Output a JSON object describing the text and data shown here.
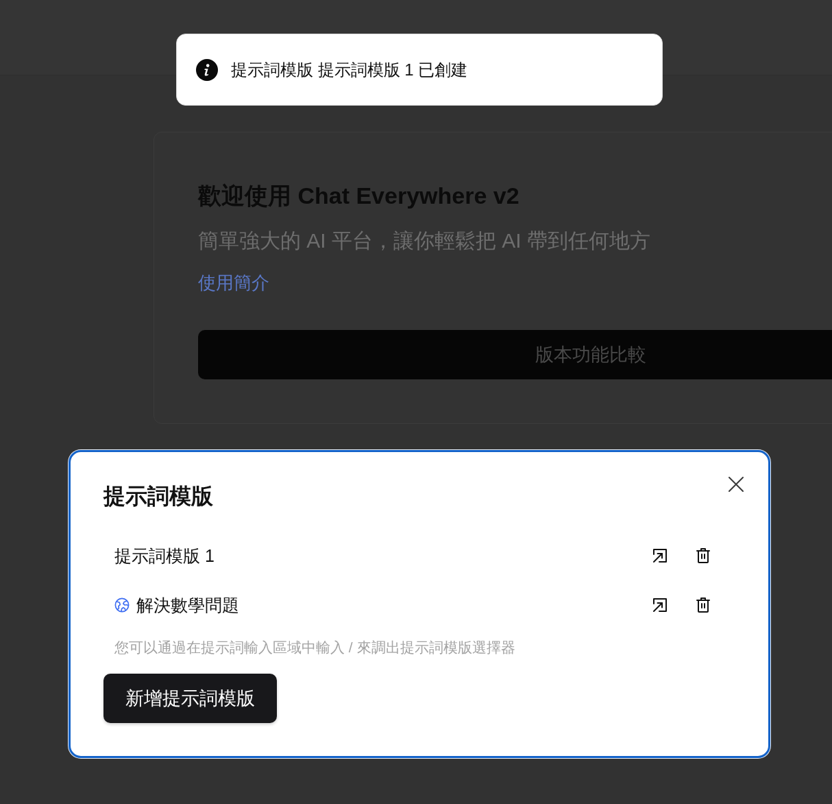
{
  "toast": {
    "message": "提示詞模版 提示詞模版 1 已創建"
  },
  "welcome_card": {
    "title": "歡迎使用 Chat Everywhere v2",
    "subtitle": "簡單強大的 AI 平台，讓你輕鬆把 AI 帶到任何地方",
    "link": "使用簡介",
    "button": "版本功能比較"
  },
  "dialog": {
    "title": "提示詞模版",
    "templates": [
      {
        "name": "提示詞模版 1",
        "kind": "custom"
      },
      {
        "name": "解決數學問題",
        "kind": "builtin"
      }
    ],
    "hint": "您可以通過在提示詞輸入區域中輸入 / 來調出提示詞模版選擇器",
    "add_button": "新增提示詞模版"
  }
}
